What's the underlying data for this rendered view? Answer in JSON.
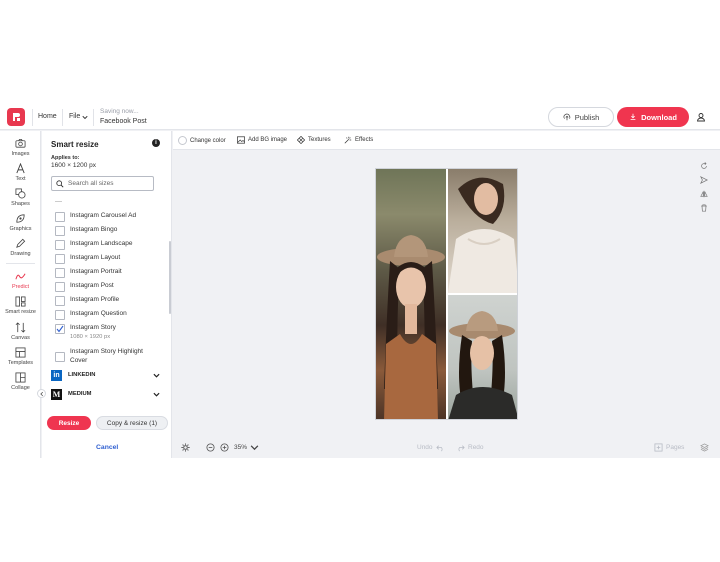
{
  "header": {
    "home_label": "Home",
    "file_label": "File",
    "saving_status": "Saving now...",
    "document_title": "Facebook Post",
    "publish_label": "Publish",
    "download_label": "Download"
  },
  "rail": {
    "items": [
      {
        "label": "Images",
        "icon": "camera-icon"
      },
      {
        "label": "Text",
        "icon": "text-icon"
      },
      {
        "label": "Shapes",
        "icon": "shapes-icon"
      },
      {
        "label": "Graphics",
        "icon": "graphics-icon"
      },
      {
        "label": "Drawing",
        "icon": "pencil-icon"
      },
      {
        "label": "Predict",
        "icon": "predict-icon"
      },
      {
        "label": "Smart resize",
        "icon": "smart-resize-icon"
      },
      {
        "label": "Canvas",
        "icon": "canvas-icon"
      },
      {
        "label": "Templates",
        "icon": "templates-icon"
      },
      {
        "label": "Collage",
        "icon": "collage-icon"
      }
    ]
  },
  "panel": {
    "title": "Smart resize",
    "applies_label": "Applies to:",
    "applies_size": "1600 × 1200 px",
    "search_placeholder": "Search all sizes",
    "list_items": [
      {
        "label": "Instagram Carousel Ad",
        "checked": false
      },
      {
        "label": "Instagram Bingo",
        "checked": false
      },
      {
        "label": "Instagram Landscape",
        "checked": false
      },
      {
        "label": "Instagram Layout",
        "checked": false
      },
      {
        "label": "Instagram Portrait",
        "checked": false
      },
      {
        "label": "Instagram Post",
        "checked": false
      },
      {
        "label": "Instagram Profile",
        "checked": false
      },
      {
        "label": "Instagram Question",
        "checked": false
      },
      {
        "label": "Instagram Story",
        "sub": "1080 × 1920 px",
        "checked": true
      },
      {
        "label": "Instagram Story Highlight Cover",
        "checked": false
      }
    ],
    "sections": [
      {
        "label": "LINKEDIN",
        "logo": "in",
        "color": "#0a66c2"
      },
      {
        "label": "MEDIUM",
        "logo": "M",
        "color": "#111111"
      }
    ],
    "resize_label": "Resize",
    "copy_resize_label": "Copy & resize (1)",
    "cancel_label": "Cancel"
  },
  "toolbar": {
    "change_color": "Change color",
    "add_bg_image": "Add BG image",
    "textures": "Textures",
    "effects": "Effects"
  },
  "bottombar": {
    "zoom": "35%",
    "undo": "Undo",
    "redo": "Redo",
    "pages": "Pages"
  },
  "colors": {
    "accent": "#f0354f",
    "link": "#2f5fd0"
  }
}
